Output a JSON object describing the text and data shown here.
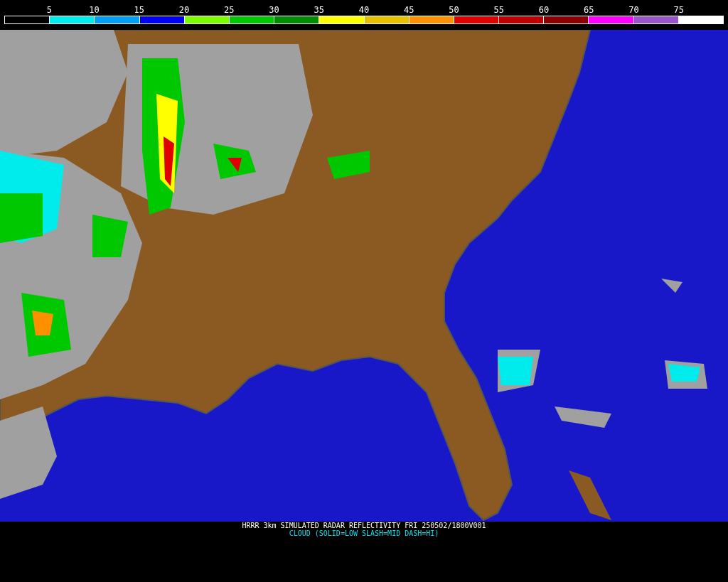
{
  "legend": {
    "segments": [
      {
        "color": "#000000",
        "label": "5"
      },
      {
        "color": "#00ecec",
        "label": "10"
      },
      {
        "color": "#01a0f6",
        "label": "15"
      },
      {
        "color": "#0000f6",
        "label": "20"
      },
      {
        "color": "#7cfc00",
        "label": "25"
      },
      {
        "color": "#00c800",
        "label": "30"
      },
      {
        "color": "#008c00",
        "label": "35"
      },
      {
        "color": "#ffff00",
        "label": "40"
      },
      {
        "color": "#e7c000",
        "label": "45"
      },
      {
        "color": "#ff9000",
        "label": "50"
      },
      {
        "color": "#e00000",
        "label": "55"
      },
      {
        "color": "#c00000",
        "label": "60"
      },
      {
        "color": "#8e0000",
        "label": "65"
      },
      {
        "color": "#ff00ff",
        "label": "70"
      },
      {
        "color": "#9955c9",
        "label": "75"
      },
      {
        "color": "#ffffff"
      }
    ]
  },
  "caption": {
    "title": "HRRR 3km SIMULATED RADAR REFLECTIVITY FRI 250502/1800V001",
    "subtitle": "CLOUD (SOLID=LOW SLASH=MID DASH=HI)"
  }
}
